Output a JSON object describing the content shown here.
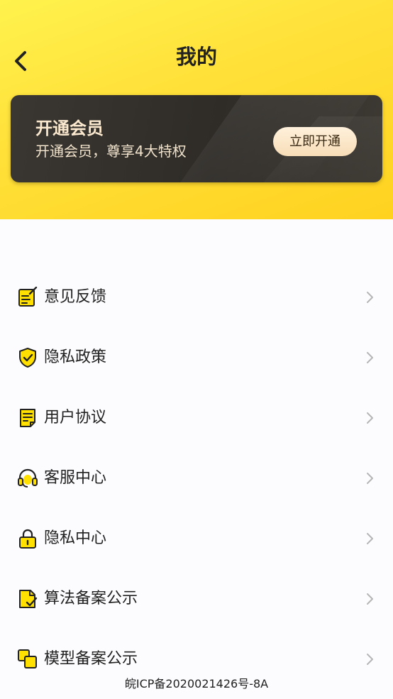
{
  "header": {
    "title": "我的"
  },
  "vip": {
    "title": "开通会员",
    "subtitle": "开通会员，尊享4大特权",
    "button_label": "立即开通"
  },
  "menu": {
    "items": [
      {
        "label": "意见反馈",
        "icon": "feedback-icon"
      },
      {
        "label": "隐私政策",
        "icon": "shield-check-icon"
      },
      {
        "label": "用户协议",
        "icon": "document-icon"
      },
      {
        "label": "客服中心",
        "icon": "headset-icon"
      },
      {
        "label": "隐私中心",
        "icon": "lock-icon"
      },
      {
        "label": "算法备案公示",
        "icon": "file-check-icon"
      },
      {
        "label": "模型备案公示",
        "icon": "layers-icon"
      }
    ]
  },
  "footer": {
    "icp": "皖ICP备2020021426号-8A"
  },
  "colors": {
    "accent_yellow": "#ffe13a",
    "icon_yellow": "#ffe000",
    "card_dark": "#2f2c28",
    "card_text": "#fbe9cf"
  }
}
